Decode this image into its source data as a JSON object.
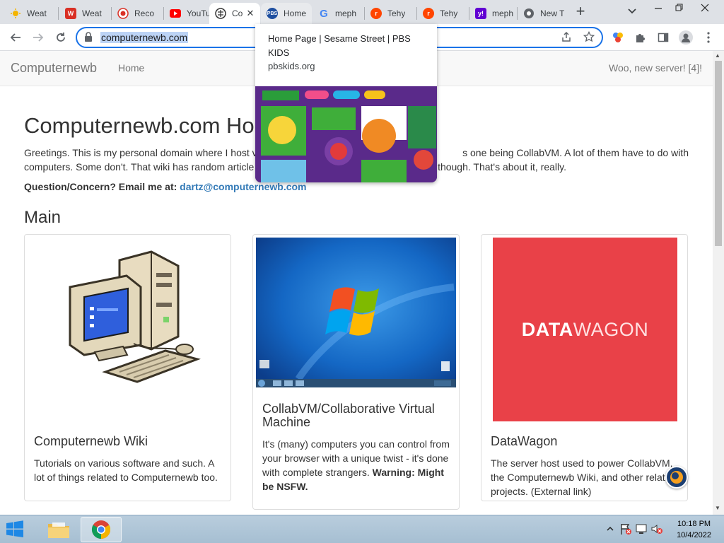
{
  "tabs": [
    {
      "title": "Weat",
      "icon": "weather-icon",
      "color": "#4a8fd4"
    },
    {
      "title": "Weat",
      "icon": "weather-icon",
      "color": "#d93025"
    },
    {
      "title": "Reco",
      "icon": "record-icon",
      "color": "#d93025"
    },
    {
      "title": "YouTu",
      "icon": "youtube-icon",
      "color": "#ff0000"
    },
    {
      "title": "Co",
      "icon": "computernewb-icon",
      "color": "#333333",
      "active": true
    },
    {
      "title": "Home",
      "icon": "pbs-kids-icon",
      "color": "#1f4fa0"
    },
    {
      "title": "meph",
      "icon": "google-icon",
      "color": "#4285f4"
    },
    {
      "title": "Tehy",
      "icon": "reddit-icon",
      "color": "#ff4500"
    },
    {
      "title": "Tehy",
      "icon": "reddit-icon",
      "color": "#ff4500"
    },
    {
      "title": "meph",
      "icon": "yahoo-icon",
      "color": "#6001d2"
    },
    {
      "title": "New T",
      "icon": "chrome-icon",
      "color": "#5f6368"
    }
  ],
  "tab_close_glyph": "✕",
  "new_tab_glyph": "+",
  "toolbar": {
    "url": "computernewb.com"
  },
  "hover_card": {
    "title": "Home Page | Sesame Street | PBS KIDS",
    "domain": "pbskids.org"
  },
  "site": {
    "brand": "Computernewb",
    "nav_home": "Home",
    "nav_right": "Woo, new server! [4]!",
    "heading": "Computernewb.com Hon",
    "intro_left": "Greetings. This is my personal domain where I host v",
    "intro_right": "s one being CollabVM. A lot of them have to do with",
    "intro_line2_left": "computers. Some don't. That wiki has random article",
    "intro_line2_right": "though. That's about it, really.",
    "contact_label": "Question/Concern? Email me at:",
    "contact_email": "dartz@computernewb.com",
    "main_heading": "Main"
  },
  "cards": [
    {
      "title": "Computernewb Wiki",
      "text": "Tutorials on various software and such. A lot of things related to Computernewb too."
    },
    {
      "title": "CollabVM/Collaborative Virtual Machine",
      "text": "It's (many) computers you can control from your browser with a unique twist - it's done with complete strangers.",
      "warning": "Warning: Might be NSFW."
    },
    {
      "title": "DataWagon",
      "logo_bold": "DATA",
      "logo_light": "WAGON",
      "text": "The server host used to power CollabVM, the Computernewb Wiki, and other relat projects. (External link)"
    }
  ],
  "taskbar": {
    "time": "10:18 PM",
    "date": "10/4/2022"
  },
  "colors": {
    "accent": "#1a73e8",
    "link": "#337ab7",
    "datawagon_red": "#e94148"
  }
}
